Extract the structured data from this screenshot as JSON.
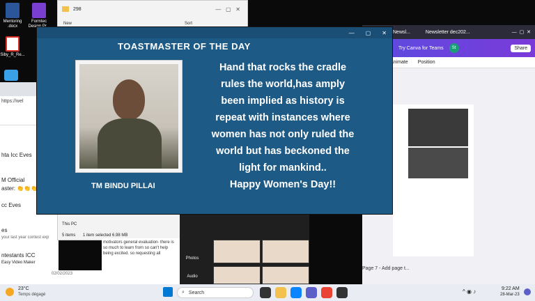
{
  "desktop": {
    "icons": [
      {
        "label": "Mentoring .docx",
        "color": "#2b579a"
      },
      {
        "label": "Formtec Design Pr...",
        "color": "#7a3fd0"
      },
      {
        "label": "Siby_R_Re...",
        "color": "#d93025"
      }
    ]
  },
  "explorer": {
    "title": "298",
    "new_label": "New",
    "sort_label": "Sort",
    "nav_item": "This PC",
    "status_items": "5 items",
    "status_selected": "1 item selected  6.98 MB"
  },
  "browser_left": {
    "url": "https://wel",
    "lines": [
      "hta Icc Eves",
      "M Official",
      "aster: 👏👏👏",
      "cc Eves",
      "es",
      "your last year contest exp",
      "ntestants ICC",
      "Easy Video Maker"
    ]
  },
  "chat_center": {
    "text": "motivators general evaluation- there is so much to learn from so can't help being excited. so requesting all",
    "date": "02/02/2023",
    "bottom_labels": [
      "Access",
      "glow",
      "general-eva..."
    ]
  },
  "photos_panel": {
    "items": [
      "Photos",
      "Audio"
    ]
  },
  "canva": {
    "tabs": [
      "Newsl...",
      "Newsletter dec202..."
    ],
    "try_label": "Try Canva for Teams",
    "avatar": "St",
    "share_label": "Share",
    "tools": [
      "Animate",
      "Position"
    ],
    "page_label": "Page 7 - Add page t..."
  },
  "popup": {
    "heading": "TOASTMASTER OF THE DAY",
    "name": "TM BINDU PILLAI",
    "quote_lines": [
      "Hand that rocks the cradle",
      "rules the world,has amply",
      "been implied as history is",
      "repeat with instances where",
      "women has not only ruled the",
      "world but has beckoned the",
      "light for mankind..",
      "Happy  Women's Day!!"
    ]
  },
  "taskbar": {
    "weather_temp": "23°C",
    "weather_desc": "Temps dégagé",
    "search_placeholder": "Search",
    "time": "9:22 AM",
    "date": "28-Mar-23"
  }
}
